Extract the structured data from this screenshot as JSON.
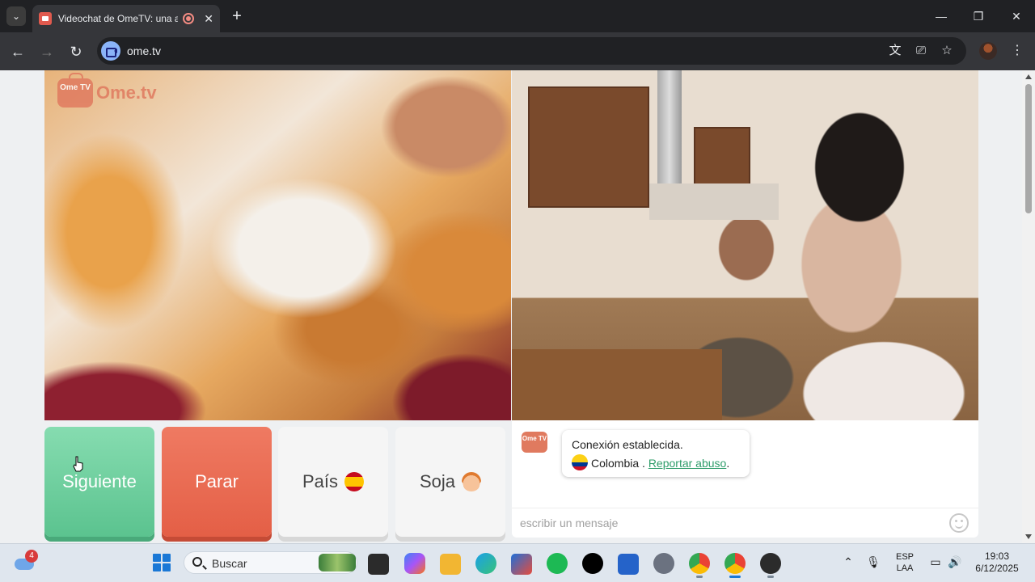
{
  "browser": {
    "tab_title": "Videochat de OmeTV: una a",
    "tab_close": "✕",
    "new_tab": "+",
    "url": "ome.tv",
    "window_controls": {
      "minimize": "—",
      "maximize": "❐",
      "close": "✕"
    }
  },
  "logo": {
    "tv_label": "Ome TV",
    "text": "Ome.tv"
  },
  "controls": {
    "next_label": "Siguiente",
    "stop_label": "Parar",
    "country_label": "País",
    "gender_label": "Soja"
  },
  "chat": {
    "logo_label": "Ome TV",
    "message_line1": "Conexión establecida.",
    "country": "Colombia",
    "separator": " . ",
    "report_link": "Reportar abuso",
    "report_suffix": ".",
    "input_placeholder": "escribir un mensaje"
  },
  "taskbar": {
    "weather_badge": "4",
    "search_placeholder": "Buscar",
    "language_line1": "ESP",
    "language_line2": "LAA",
    "time": "19:03",
    "date": "6/12/2025"
  },
  "colors": {
    "next_button": "#5bc38f",
    "stop_button": "#e45f46",
    "brand": "#e07a5f",
    "link": "#2e9c6a"
  },
  "icons": {
    "tab_search": "chevron-down-icon",
    "back": "arrow-left-icon",
    "forward": "arrow-right-icon",
    "reload": "reload-icon",
    "translate": "translate-icon",
    "cast": "cast-icon",
    "bookmark": "star-icon",
    "menu": "more-vert-icon",
    "emoji": "smiley-icon"
  }
}
